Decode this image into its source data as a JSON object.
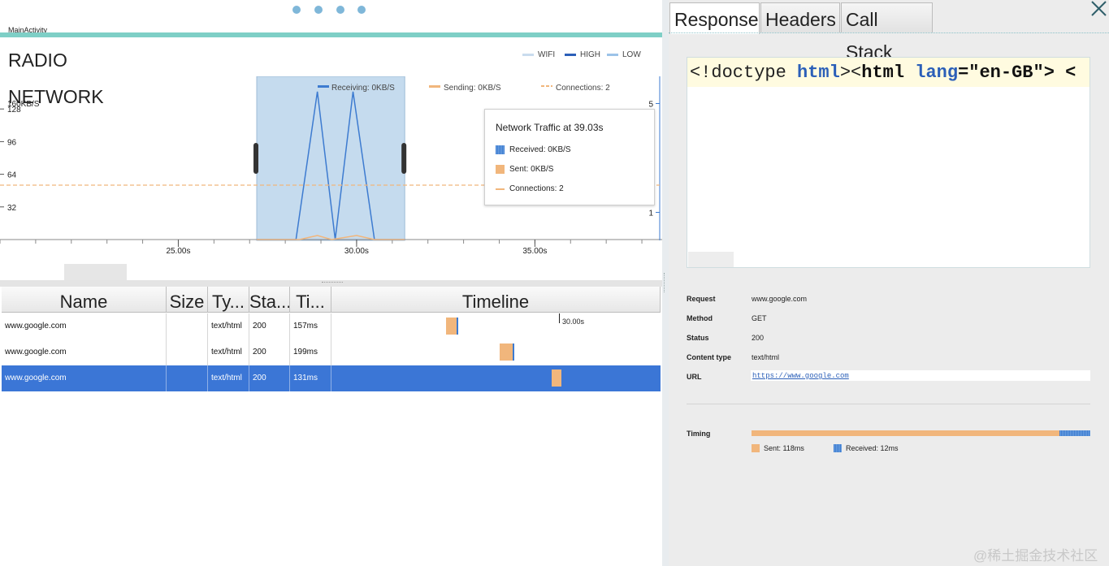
{
  "activity": "MainActivity",
  "radio_label": "RADIO",
  "network_label": "NETWORK",
  "radio_legend": [
    {
      "label": "WIFI",
      "color": "#c9dcee"
    },
    {
      "label": "HIGH",
      "color": "#2b5fb8"
    },
    {
      "label": "LOW",
      "color": "#9cc3e8"
    }
  ],
  "network_legend": {
    "receiving": "Receiving: 0KB/S",
    "sending": "Sending: 0KB/S",
    "connections": "Connections: 2"
  },
  "colors": {
    "received": "#3d7bd0",
    "sent": "#f1b67c",
    "selection": "#3b76d6",
    "teal": "#7ecfc6"
  },
  "chart_data": {
    "type": "line",
    "xlabel": "",
    "ylabel": "",
    "y_unit_label": "160KB/S",
    "y_ticks": [
      32,
      64,
      96,
      128
    ],
    "ylim": [
      0,
      160
    ],
    "y2_ticks": [
      1,
      5
    ],
    "y2lim": [
      0,
      6
    ],
    "xlim": [
      20.0,
      38.5
    ],
    "x_ticks": [
      "25.00s",
      "30.00s",
      "35.00s"
    ],
    "x_tick_values": [
      25.0,
      30.0,
      35.0
    ],
    "selection_range": [
      27.2,
      31.35
    ],
    "series": [
      {
        "name": "Receiving",
        "x": [
          27.2,
          28.3,
          28.9,
          29.4,
          29.9,
          30.5,
          31.35
        ],
        "y": [
          0,
          0,
          145,
          0,
          145,
          0,
          0
        ]
      },
      {
        "name": "Sending",
        "x": [
          27.2,
          28.4,
          28.9,
          29.3,
          30.0,
          30.5,
          31.35
        ],
        "y": [
          0,
          0,
          4,
          0,
          4,
          0,
          0
        ]
      },
      {
        "name": "Connections",
        "x": [
          20.0,
          38.5
        ],
        "y": [
          2,
          2
        ]
      }
    ]
  },
  "tooltip": {
    "title": "Network Traffic at 39.03s",
    "received": "Received: 0KB/S",
    "sent": "Sent: 0KB/S",
    "connections": "Connections: 2"
  },
  "table": {
    "headers": [
      "Name",
      "Size",
      "Ty...",
      "Sta...",
      "Ti...",
      "Timeline"
    ],
    "timeline_marker": "30.00s",
    "rows": [
      {
        "name": "www.google.com",
        "size": "",
        "type": "text/html",
        "status": "200",
        "time": "157ms",
        "timeline_start": 0.347,
        "timeline_sent": 0.033,
        "timeline_received": 0.005,
        "selected": false
      },
      {
        "name": "www.google.com",
        "size": "",
        "type": "text/html",
        "status": "200",
        "time": "199ms",
        "timeline_start": 0.51,
        "timeline_sent": 0.041,
        "timeline_received": 0.005,
        "selected": false
      },
      {
        "name": "www.google.com",
        "size": "",
        "type": "text/html",
        "status": "200",
        "time": "131ms",
        "timeline_start": 0.668,
        "timeline_sent": 0.03,
        "timeline_received": 0.0,
        "selected": true
      }
    ]
  },
  "tabs": [
    "Response",
    "Headers",
    "Call Stack"
  ],
  "response": {
    "code_parts": [
      "<!doctype ",
      "html",
      "><",
      "html",
      " ",
      "lang",
      "=\"en-GB\"> <"
    ]
  },
  "details": {
    "request_label": "Request",
    "request": "www.google.com",
    "method_label": "Method",
    "method": "GET",
    "status_label": "Status",
    "status": "200",
    "content_type_label": "Content type",
    "content_type": "text/html",
    "url_label": "URL",
    "url": "https://www.google.com"
  },
  "timing": {
    "label": "Timing",
    "sent": "Sent: 118ms",
    "received": "Received: 12ms",
    "sent_ms": 118,
    "received_ms": 12
  },
  "watermark": "@稀土掘金技术社区"
}
